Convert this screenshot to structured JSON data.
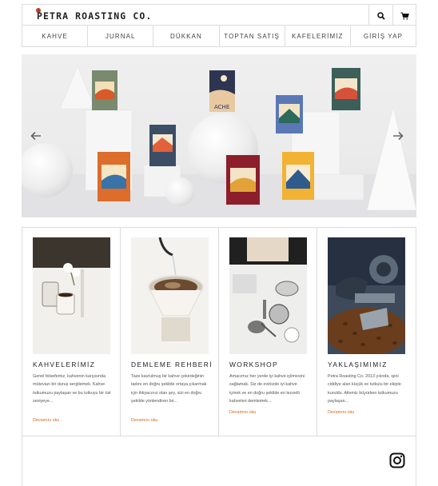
{
  "header": {
    "logo_text": "PETRA ROASTING CO.",
    "logo_accent_color": "#c0392b",
    "search_icon": "search-icon",
    "cart_icon": "cart-icon"
  },
  "nav": {
    "items": [
      {
        "label": "KAHVE"
      },
      {
        "label": "JURNAL"
      },
      {
        "label": "DÜKKAN"
      },
      {
        "label": "TOPTAN SATIŞ"
      },
      {
        "label": "KAFELERİMİZ"
      },
      {
        "label": "GİRİŞ YAP"
      }
    ]
  },
  "hero": {
    "prev_icon": "chevron-left-icon",
    "next_icon": "chevron-right-icon",
    "package_label": "ACHE"
  },
  "cards": [
    {
      "title": "KAHVELERİMİZ",
      "text": "Genel felsefemiz, kahvenin karşısında mütevazı bir duruş sergilemek. Kahve tutkumuzu paylaşan ve bu tutkuyu bir üst seviyeye...",
      "more": "Devamını oku"
    },
    {
      "title": "DEMLEME REHBERİ",
      "text": "Taze kavrulmuş bir kahve çekirdeğinin tadını en doğru şekilde ortaya çıkarmak için ihtiyacınız olan şey, sizi en doğru şekilde yönlendiren bir...",
      "more": "Devamını oku"
    },
    {
      "title": "WORKSHOP",
      "text": "Amacımız her yerde iyi kahve içilmesini sağlamak. Siz de evinizde iyi kahve içmek ve en doğru şekilde en lezzetli kahveleri demlemek...",
      "more": "Devamını oku"
    },
    {
      "title": "YAKLAŞIMIMIZ",
      "text": "Petra Roasting Co. 2013 yılında, işini ciddiye alan küçük ve tutkulu bir ekiple kuruldu. Ailemiz büyürken tutkumuzu paylaşan...",
      "more": "Devamını oku"
    }
  ],
  "footer": {
    "instagram_icon": "instagram-icon"
  }
}
